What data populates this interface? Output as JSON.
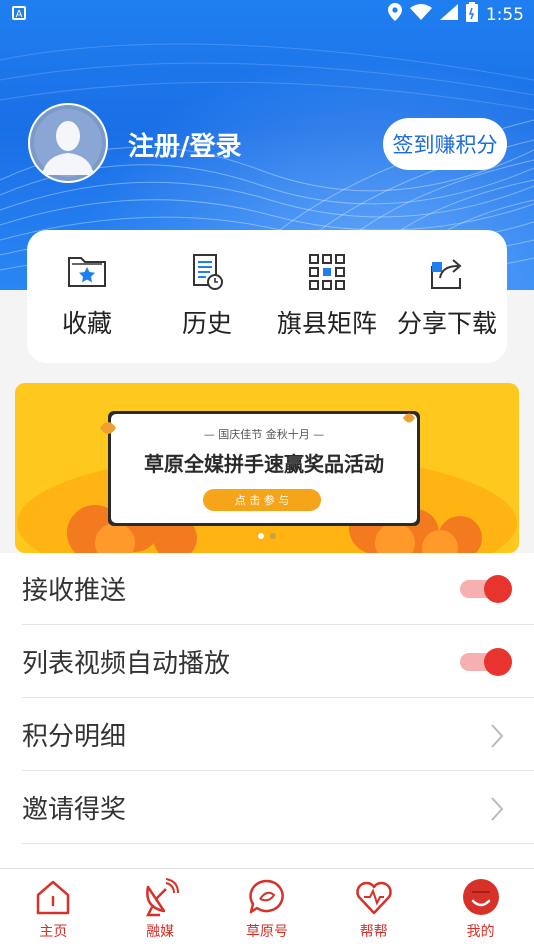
{
  "status_bar": {
    "time": "1:55"
  },
  "profile": {
    "login_text": "注册/登录",
    "signin_button": "签到赚积分"
  },
  "quick_actions": [
    {
      "label": "收藏",
      "icon": "favorites-folder-icon"
    },
    {
      "label": "历史",
      "icon": "history-document-icon"
    },
    {
      "label": "旗县矩阵",
      "icon": "grid-matrix-icon"
    },
    {
      "label": "分享下载",
      "icon": "share-icon"
    }
  ],
  "banner": {
    "top_line": "— 国庆佳节  金秋十月 —",
    "title": "草原全媒拼手速赢奖品活动",
    "button": "点 击 参 与"
  },
  "settings": [
    {
      "label": "接收推送",
      "control": "toggle",
      "on": true
    },
    {
      "label": "列表视频自动播放",
      "control": "toggle",
      "on": true
    },
    {
      "label": "积分明细",
      "control": "chevron"
    },
    {
      "label": "邀请得奖",
      "control": "chevron"
    }
  ],
  "tabs": [
    {
      "label": "主页",
      "icon": "home-icon"
    },
    {
      "label": "融媒",
      "icon": "satellite-dish-icon"
    },
    {
      "label": "草原号",
      "icon": "chat-bubble-icon"
    },
    {
      "label": "帮帮",
      "icon": "heart-pulse-icon"
    },
    {
      "label": "我的",
      "icon": "profile-face-icon"
    }
  ],
  "colors": {
    "primary": "#1f7ff0",
    "accent": "#d7322a",
    "banner_yellow": "#ffc81c"
  }
}
